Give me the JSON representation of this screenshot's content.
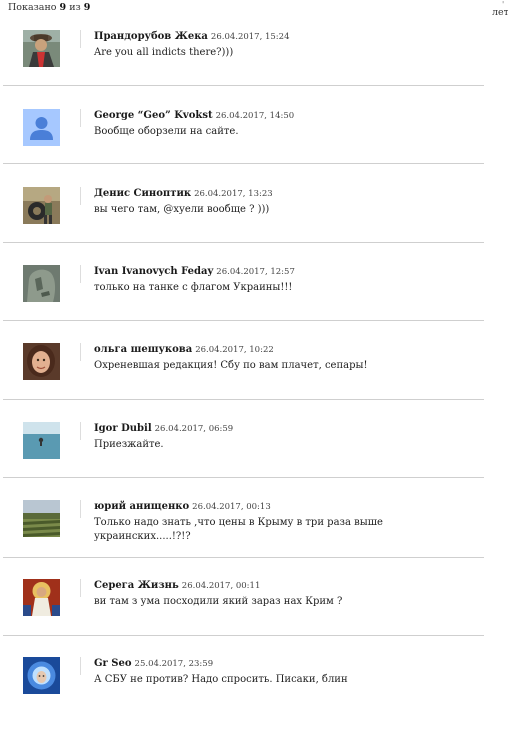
{
  "header": {
    "shown_prefix": "Показано",
    "shown_count": "9",
    "shown_of": "из",
    "shown_total": "9",
    "right_clip": "лет"
  },
  "comments": [
    {
      "author": "Прандорубов Жека",
      "date": "26.04.2017, 15:24",
      "text": "Are you all indicts there?)))",
      "avatar": "person-in-hat"
    },
    {
      "author": "George “Geo” Kvokst",
      "date": "26.04.2017, 14:50",
      "text": "Вообще оборзели на сайте.",
      "avatar": "default-user"
    },
    {
      "author": "Денис Синоптик",
      "date": "26.04.2017, 13:23",
      "text": "вы чего там, @хуели вообще ? )))",
      "avatar": "person-with-tire"
    },
    {
      "author": "Ivan Ivanovych Feday",
      "date": "26.04.2017, 12:57",
      "text": "только на танке с флагом Украины!!!",
      "avatar": "stone-face"
    },
    {
      "author": "ольга шешукова",
      "date": "26.04.2017, 10:22",
      "text": "Охреневшая редакция! Сбу по вам плачет, сепары!",
      "avatar": "woman-portrait"
    },
    {
      "author": "Igor Dubil",
      "date": "26.04.2017, 06:59",
      "text": "Приезжайте.",
      "avatar": "sea-swimmer"
    },
    {
      "author": "юрий анищенко",
      "date": "26.04.2017, 00:13",
      "text": "Только надо знать ,что цены в Крыму в три раза выше украинских.....!?!?",
      "avatar": "vineyard-landscape"
    },
    {
      "author": "Серега Жизнь",
      "date": "26.04.2017, 00:11",
      "text": "ви там з ума посходили який зараз нах Крим ?",
      "avatar": "religious-icon"
    },
    {
      "author": "Gr Seo",
      "date": "25.04.2017, 23:59",
      "text": "А СБУ не против? Надо спросить. Писаки, блин",
      "avatar": "blue-glow-face"
    }
  ]
}
